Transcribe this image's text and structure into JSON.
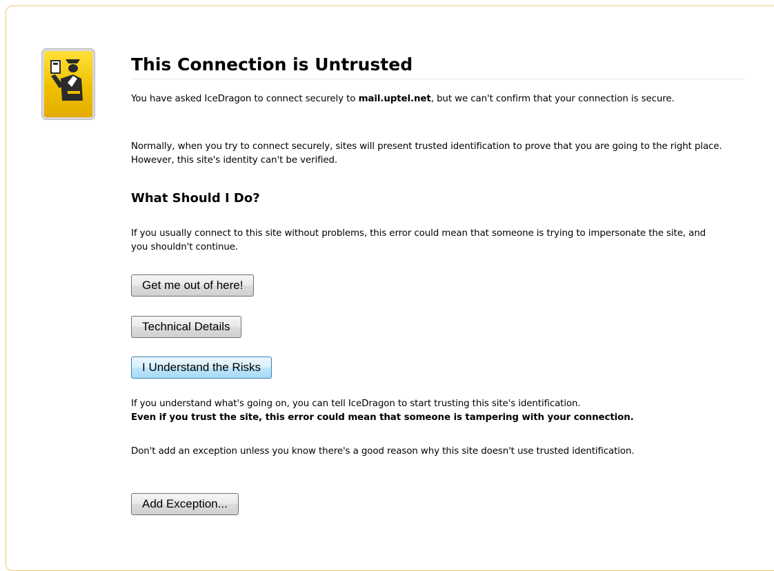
{
  "page": {
    "title": "This Connection is Untrusted",
    "intro": {
      "before": "You have asked IceDragon to connect securely to ",
      "host": "mail.uptel.net",
      "after": ", but we can't confirm that your connection is secure."
    },
    "normally": "Normally, when you try to connect securely, sites will present trusted identification to prove that you are going to the right place. However, this site's identity can't be verified.",
    "what_heading": "What Should I Do?",
    "what_text": "If you usually connect to this site without problems, this error could mean that someone is trying to impersonate the site, and you shouldn't continue.",
    "buttons": {
      "get_out": "Get me out of here!",
      "technical": "Technical Details",
      "understand": "I Understand the Risks",
      "add_exception": "Add Exception..."
    },
    "risk_text": "If you understand what's going on, you can tell IceDragon to start trusting this site's identification.",
    "risk_bold": "Even if you trust the site, this error could mean that someone is tampering with your connection.",
    "exception_text": "Don't add an exception unless you know there's a good reason why this site doesn't use trusted identification."
  },
  "icon": "security-officer-icon",
  "colors": {
    "frame_border": "#f0c36a",
    "icon_yellow": "#f0c000",
    "button_active_border": "#3c7fb1"
  }
}
